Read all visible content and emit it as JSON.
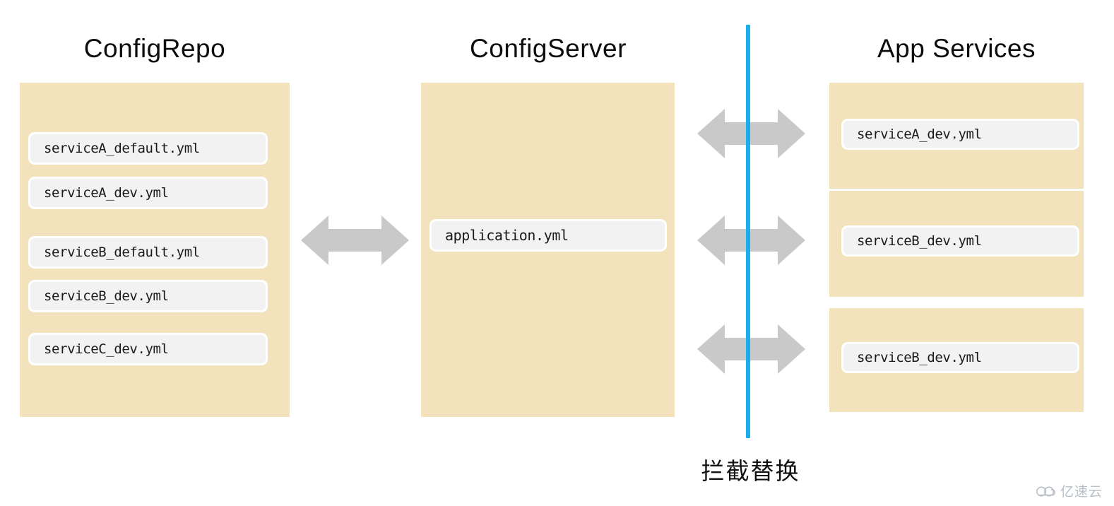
{
  "columns": {
    "repo": {
      "title": "ConfigRepo",
      "files": [
        "serviceA_default.yml",
        "serviceA_dev.yml",
        "serviceB_default.yml",
        "serviceB_dev.yml",
        "serviceC_dev.yml"
      ]
    },
    "server": {
      "title": "ConfigServer",
      "files": [
        "application.yml"
      ]
    },
    "app": {
      "title": "App Services",
      "files": [
        "serviceA_dev.yml",
        "serviceB_dev.yml",
        "serviceB_dev.yml"
      ]
    }
  },
  "caption": "拦截替换",
  "watermark": {
    "text": "亿速云",
    "icon": "cloud-icon"
  },
  "colors": {
    "panel_beige": "#F2E3BD",
    "chip_gray": "#F2F2F2",
    "arrow_gray": "#C9C9C9",
    "accent_blue": "#1AAFEA",
    "background": "#FFFFFF",
    "text": "#0D0D0D"
  },
  "icons": {
    "arrow": "double-headed-arrow-icon",
    "divider": "interception-line-icon"
  }
}
